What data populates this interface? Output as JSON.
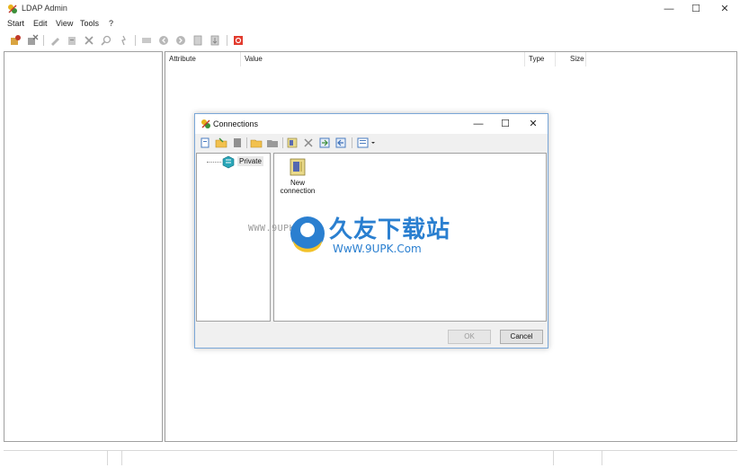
{
  "window": {
    "title": "LDAP Admin",
    "controls": {
      "minimize": "—",
      "maximize": "☐",
      "close": "✕"
    }
  },
  "menu": [
    "Start",
    "Edit",
    "View",
    "Tools",
    "?"
  ],
  "toolbar": {
    "icons": [
      "connect-icon",
      "disconnect-icon",
      "edit-icon",
      "properties-icon",
      "delete-icon",
      "search-icon",
      "refresh-icon",
      "schema-icon",
      "back-icon",
      "forward-icon",
      "export-icon",
      "import-icon",
      "exit-icon"
    ]
  },
  "attributes_view": {
    "columns": [
      "Attribute",
      "Value",
      "Type",
      "Size"
    ]
  },
  "connections_dialog": {
    "title": "Connections",
    "controls": {
      "minimize": "—",
      "maximize": "☐",
      "close": "✕"
    },
    "tree": {
      "root_label": "Private"
    },
    "list": {
      "items": [
        {
          "label_line1": "New",
          "label_line2": "connection"
        }
      ]
    },
    "buttons": {
      "ok": "OK",
      "cancel": "Cancel"
    }
  },
  "watermark": {
    "left_text": "WWW.9UPK.COM",
    "chinese": "久友下载站",
    "url": "WwW.9UPK.Com"
  },
  "colors": {
    "dialog_border": "#7aa7d8",
    "watermark_blue": "#2a7fd0",
    "close_red": "#e23b2e"
  }
}
